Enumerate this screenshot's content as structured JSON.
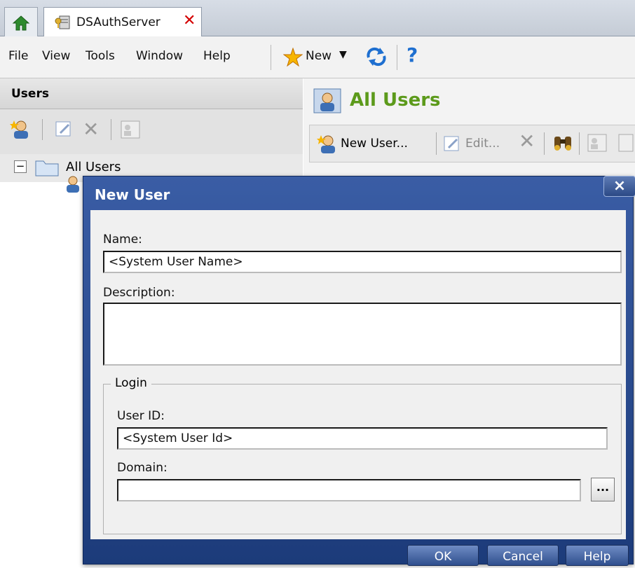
{
  "tab": {
    "title": "DSAuthServer"
  },
  "menubar": {
    "items": [
      "File",
      "View",
      "Tools",
      "Window",
      "Help"
    ],
    "new_label": "New"
  },
  "left_pane": {
    "header": "Users",
    "tree": {
      "root_label": "All Users",
      "expander": "−"
    }
  },
  "right_pane": {
    "title": "All Users",
    "toolbar": {
      "new_user": "New User...",
      "edit": "Edit..."
    }
  },
  "dialog": {
    "title": "New User",
    "close": "×",
    "name_label": "Name:",
    "name_value": "<System User Name>",
    "description_label": "Description:",
    "description_value": "",
    "login_group": "Login",
    "user_id_label": "User ID:",
    "user_id_value": "<System User Id>",
    "domain_label": "Domain:",
    "domain_value": "",
    "browse": "...",
    "buttons": {
      "ok": "OK",
      "cancel": "Cancel",
      "help": "Help"
    }
  },
  "colors": {
    "accent_green": "#5c9a1b",
    "dialog_blue": "#2c4a86",
    "tab_close_red": "#d40000"
  }
}
